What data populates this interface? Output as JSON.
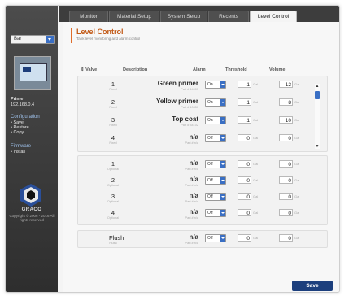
{
  "tabs": [
    "Monitor",
    "Material Setup",
    "System Setup",
    "Recents",
    "Level Control"
  ],
  "active_tab": "Level Control",
  "sidebar": {
    "select_value": "Bar",
    "device_name": "Prime",
    "device_ip": "192.168.0.4",
    "config_heading": "Configuration",
    "config_items": [
      "• Save",
      "• Restore",
      "• Copy"
    ],
    "firmware_heading": "Firmware",
    "firmware_items": [
      "• Install"
    ],
    "logo_name": "GRACO",
    "copyright": "Copyright © 2006 - 2016 All rights reserved"
  },
  "page": {
    "title": "Level Control",
    "subtitle": "Tank level monitoring and alarm control"
  },
  "columns": {
    "valve": "Valve",
    "description": "Description",
    "alarm": "Alarm",
    "threshold": "Threshold",
    "volume": "Volume"
  },
  "unit": "Gal",
  "rows_top": [
    {
      "num": "1",
      "sub": "Fixed",
      "desc": "Green primer",
      "dsub": "Part # 14003",
      "alarm": "On",
      "threshold": "1",
      "volume": "12"
    },
    {
      "num": "2",
      "sub": "Fixed",
      "desc": "Yellow primer",
      "dsub": "Part # 10450",
      "alarm": "On",
      "threshold": "1",
      "volume": "8"
    },
    {
      "num": "3",
      "sub": "Fixed",
      "desc": "Top coat",
      "dsub": "Part # 34102",
      "alarm": "On",
      "threshold": "1",
      "volume": "10"
    },
    {
      "num": "4",
      "sub": "Fixed",
      "desc": "n/a",
      "dsub": "Part # n/a",
      "alarm": "Off",
      "threshold": "0",
      "volume": "0"
    }
  ],
  "rows_mid": [
    {
      "num": "1",
      "sub": "Optional",
      "desc": "n/a",
      "dsub": "Part # n/a",
      "alarm": "Off",
      "threshold": "0",
      "volume": "0"
    },
    {
      "num": "2",
      "sub": "Optional",
      "desc": "n/a",
      "dsub": "Part # n/a",
      "alarm": "Off",
      "threshold": "0",
      "volume": "0"
    },
    {
      "num": "3",
      "sub": "Optional",
      "desc": "n/a",
      "dsub": "Part # n/a",
      "alarm": "Off",
      "threshold": "0",
      "volume": "0"
    },
    {
      "num": "4",
      "sub": "Optional",
      "desc": "n/a",
      "dsub": "Part # n/a",
      "alarm": "Off",
      "threshold": "0",
      "volume": "0"
    }
  ],
  "flush_row": {
    "num": "Flush",
    "sub": "Flush",
    "desc": "n/a",
    "dsub": "Part # n/a",
    "alarm": "Off",
    "threshold": "0",
    "volume": "0"
  },
  "save_label": "Save",
  "colors": {
    "accent": "#c25a17",
    "primary": "#1c3f7d",
    "control": "#3a6fc4"
  }
}
